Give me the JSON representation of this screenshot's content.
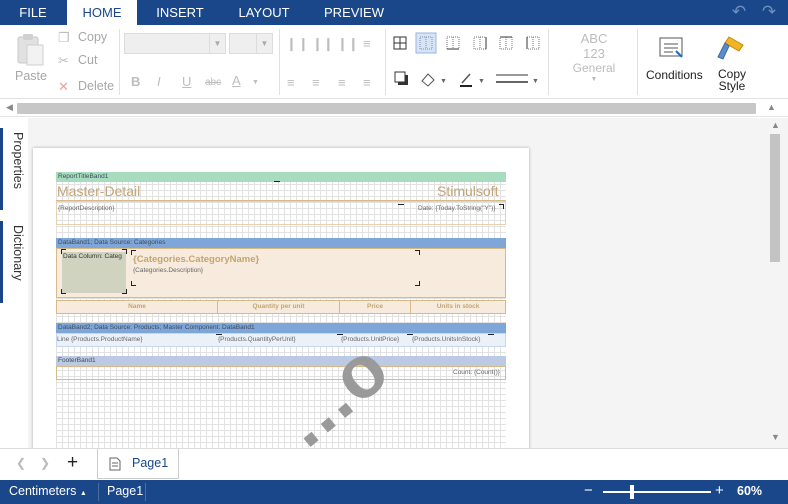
{
  "menu": {
    "tabs": [
      {
        "label": "FILE"
      },
      {
        "label": "HOME"
      },
      {
        "label": "INSERT"
      },
      {
        "label": "LAYOUT"
      },
      {
        "label": "PREVIEW"
      }
    ],
    "active_tab": "HOME"
  },
  "ribbon": {
    "paste": "Paste",
    "copy": "Copy",
    "cut": "Cut",
    "delete": "Delete",
    "style_abc": "ABC",
    "style_123": "123",
    "general": "General",
    "conditions": "Conditions",
    "copy_style_line1": "Copy",
    "copy_style_line2": "Style"
  },
  "side": {
    "properties": "Properties",
    "dictionary": "Dictionary"
  },
  "report": {
    "title_band": "ReportTitleBand1",
    "title_left": "Master-Detail",
    "title_right": "Stimulsoft",
    "description": "{ReportDescription}",
    "date": "Date: {Today.ToString(\"Y\")}",
    "databand1": "DataBand1; Data Source: Categories",
    "data_column": "Data Column: Categ",
    "category_name": "{Categories.CategoryName}",
    "category_desc": "{Categories.Description}",
    "headers": [
      "Name",
      "Quantity per unit",
      "Price",
      "Units in stock"
    ],
    "databand2": "DataBand2; Data Source: Products; Master Component: DataBand1",
    "row_fields": [
      "Line",
      "{Products.ProductName}",
      "{Products.QuantityPerUnit}",
      "{Products.UnitPrice}",
      "{Products.UnitsInStock}"
    ],
    "footer_band": "FooterBand1",
    "count": "Count: {Count()}",
    "watermark": "...o"
  },
  "pages": {
    "tab_label": "Page1"
  },
  "status": {
    "units": "Centimeters",
    "page": "Page1",
    "zoom": "60%",
    "zoom_value": 60
  },
  "colors": {
    "brand": "#19478a",
    "title_band": "#a8dcbf",
    "data_band": "#7fa6d9",
    "accent_text": "#c4a471"
  }
}
